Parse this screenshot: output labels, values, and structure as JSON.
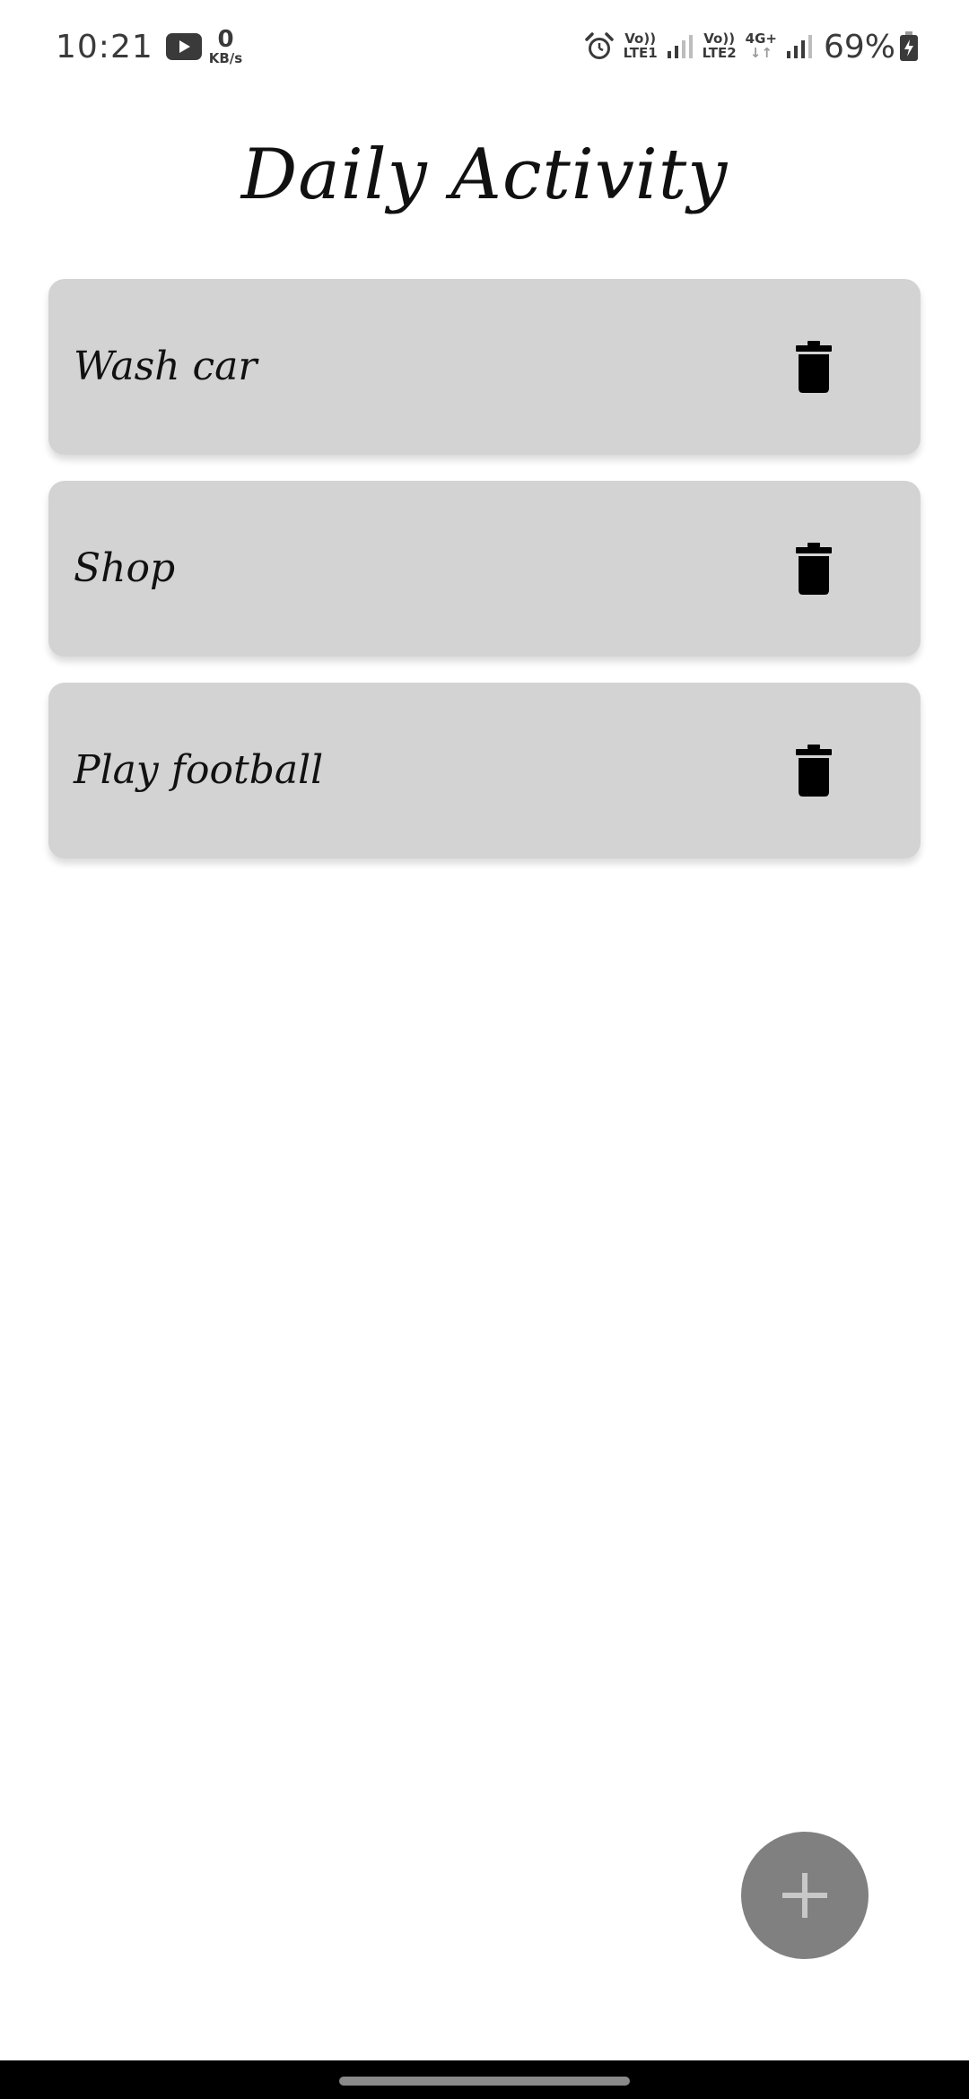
{
  "status_bar": {
    "time": "10:21",
    "net_speed_value": "0",
    "net_speed_unit": "KB/s",
    "sim1_top": "Vo))",
    "sim1_bottom": "LTE1",
    "sim2_top": "Vo))",
    "sim2_bottom": "LTE2",
    "network_type": "4G+",
    "battery": "69%",
    "icons": [
      "youtube-icon",
      "alarm-icon",
      "signal-icon",
      "battery-icon"
    ]
  },
  "title": "Daily Activity",
  "tasks": [
    {
      "label": "Wash car"
    },
    {
      "label": "Shop"
    },
    {
      "label": "Play football"
    }
  ],
  "colors": {
    "card_background": "#d3d3d3",
    "fab_background": "#808080",
    "fab_icon": "#c8c8c8",
    "page_background": "#ffffff"
  }
}
